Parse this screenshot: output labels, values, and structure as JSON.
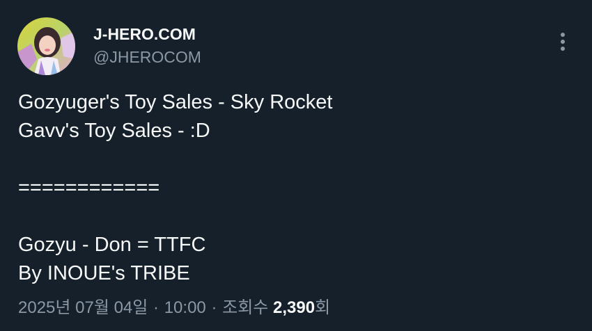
{
  "author": {
    "display_name": "J-HERO.COM",
    "handle": "@JHEROCOM",
    "avatar_icon": "profile-photo"
  },
  "post": {
    "lines": [
      "Gozyuger's Toy Sales - Sky Rocket",
      "Gavv's Toy Sales - :D",
      "",
      "============",
      "",
      "Gozyu - Don = TTFC",
      "By INOUE's TRIBE"
    ]
  },
  "meta": {
    "date": "2025년 07월 04일",
    "separator": "·",
    "time": "10:00",
    "views_label": "조회수",
    "views_count": "2,390",
    "views_suffix": "회"
  },
  "menu": {
    "icon": "more-vertical-icon"
  },
  "colors": {
    "background": "#15202b",
    "primary_text": "#f7f9f9",
    "secondary_text": "#8b98a5"
  }
}
